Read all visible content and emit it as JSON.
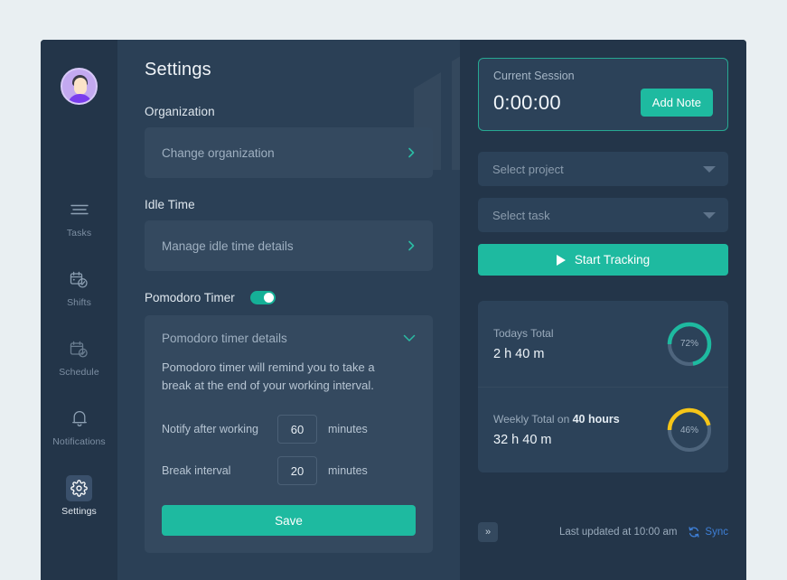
{
  "colors": {
    "page_bg": "#e9eff2",
    "sidebar_bg": "#233549",
    "main_bg": "#2b4056",
    "panel_bg": "#34495f",
    "accent_teal": "#1ebaa0",
    "accent_yellow": "#f5c518",
    "sync_blue": "#3e7fd6",
    "ring_track": "#4e657d"
  },
  "sidebar": {
    "avatar_name": "user-avatar",
    "items": [
      {
        "label": "Tasks",
        "icon": "tasks-icon",
        "active": false
      },
      {
        "label": "Shifts",
        "icon": "shifts-icon",
        "active": false
      },
      {
        "label": "Schedule",
        "icon": "schedule-icon",
        "active": false
      },
      {
        "label": "Notifications",
        "icon": "bell-icon",
        "active": false
      },
      {
        "label": "Settings",
        "icon": "gear-icon",
        "active": true
      }
    ]
  },
  "main": {
    "page_title": "Settings",
    "organization": {
      "section_label": "Organization",
      "row_label": "Change organization"
    },
    "idle_time": {
      "section_label": "Idle Time",
      "row_label": "Manage idle time details"
    },
    "pomodoro": {
      "toggle_label": "Pomodoro Timer",
      "toggle_on": true,
      "details_label": "Pomodoro timer details",
      "description": "Pomodoro timer will remind you to take a break at the end of your working interval.",
      "notify_label": "Notify after working",
      "notify_value": "60",
      "notify_unit": "minutes",
      "break_label": "Break interval",
      "break_value": "20",
      "break_unit": "minutes",
      "save_label": "Save"
    }
  },
  "right": {
    "session": {
      "label": "Current Session",
      "time": "0:00:00",
      "add_note_label": "Add Note"
    },
    "project_select": {
      "value": "Select project"
    },
    "task_select": {
      "value": "Select task"
    },
    "start_button_label": "Start Tracking",
    "totals": [
      {
        "label": "Todays Total",
        "label_highlight": "",
        "value": "2 h 40 m",
        "percent": 72,
        "percent_text": "72%",
        "ring_color": "#1ebaa0"
      },
      {
        "label": "Weekly Total on ",
        "label_highlight": "40 hours",
        "value": "32 h 40 m",
        "percent": 46,
        "percent_text": "46%",
        "ring_color": "#f5c518"
      }
    ],
    "footer": {
      "collapse_label": "»",
      "updated_text": "Last updated at 10:00 am",
      "sync_label": "Sync"
    }
  }
}
